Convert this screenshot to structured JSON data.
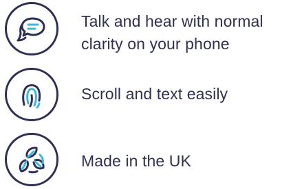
{
  "features": [
    {
      "icon": "chat-bubbles-icon",
      "lines": [
        "Talk and hear with normal",
        "clarity on your phone"
      ]
    },
    {
      "icon": "fingerprint-icon",
      "lines": [
        "Scroll and text easily"
      ]
    },
    {
      "icon": "recycle-icon",
      "lines": [
        "Made in the UK"
      ]
    }
  ],
  "colors": {
    "outline": "#2d2f55",
    "accent": "#3cb7dd",
    "text": "#2f3152"
  }
}
